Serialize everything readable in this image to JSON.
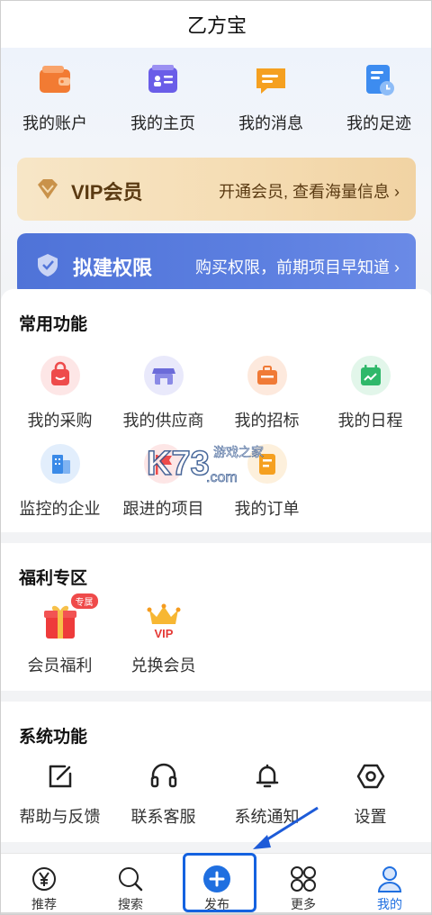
{
  "header": {
    "title": "乙方宝"
  },
  "quick_links": [
    {
      "label": "我的账户",
      "icon": "wallet-icon",
      "color": "#f27b33"
    },
    {
      "label": "我的主页",
      "icon": "profile-card-icon",
      "color": "#6a5de8"
    },
    {
      "label": "我的消息",
      "icon": "message-icon",
      "color": "#f5a020"
    },
    {
      "label": "我的足迹",
      "icon": "history-icon",
      "color": "#3d8cf0"
    }
  ],
  "vip_banner": {
    "title": "VIP会员",
    "subtitle": "开通会员, 查看海量信息 ›",
    "icon": "diamond-icon"
  },
  "build_banner": {
    "title": "拟建权限",
    "subtitle": "购买权限，前期项目早知道 ›",
    "icon": "shield-badge-icon"
  },
  "common_functions": {
    "title": "常用功能",
    "items": [
      {
        "label": "我的采购",
        "icon": "shopping-bag-icon",
        "bg": "#fde6e6",
        "color": "#ee4b4b"
      },
      {
        "label": "我的供应商",
        "icon": "store-icon",
        "bg": "#e9e9fb",
        "color": "#6b6bd9"
      },
      {
        "label": "我的招标",
        "icon": "briefcase-icon",
        "bg": "#fde9dd",
        "color": "#f07a36"
      },
      {
        "label": "我的日程",
        "icon": "calendar-icon",
        "bg": "#e2f6ea",
        "color": "#2fb86a"
      },
      {
        "label": "监控的企业",
        "icon": "building-icon",
        "bg": "#e2eefc",
        "color": "#3a8ae8"
      },
      {
        "label": "跟进的项目",
        "icon": "flag-icon",
        "bg": "#fde6e6",
        "color": "#ee4b4b"
      },
      {
        "label": "我的订单",
        "icon": "order-icon",
        "bg": "#fdf0dc",
        "color": "#f5a020"
      }
    ]
  },
  "welfare": {
    "title": "福利专区",
    "items": [
      {
        "label": "会员福利",
        "icon": "gift-icon",
        "badge": "专属"
      },
      {
        "label": "兑换会员",
        "icon": "vip-crown-icon",
        "badge_text": "VIP"
      }
    ]
  },
  "system_functions": {
    "title": "系统功能",
    "items": [
      {
        "label": "帮助与反馈",
        "icon": "edit-icon"
      },
      {
        "label": "联系客服",
        "icon": "headset-icon"
      },
      {
        "label": "系统通知",
        "icon": "bell-icon"
      },
      {
        "label": "设置",
        "icon": "settings-hexagon-icon"
      }
    ]
  },
  "watermark": {
    "brand": "K73",
    "domain": ".com",
    "tagline": "游戏之家"
  },
  "bottom_nav": {
    "items": [
      {
        "label": "推荐",
        "icon": "yen-icon",
        "active": false
      },
      {
        "label": "搜索",
        "icon": "search-icon",
        "active": false
      },
      {
        "label": "发布",
        "icon": "plus-circle-icon",
        "active": false
      },
      {
        "label": "更多",
        "icon": "grid-icon",
        "active": false
      },
      {
        "label": "我的",
        "icon": "user-icon",
        "active": true
      }
    ]
  },
  "colors": {
    "accent": "#1f6fe0",
    "vip_gold": "#f1d3a3",
    "build_blue": "#5376da"
  }
}
